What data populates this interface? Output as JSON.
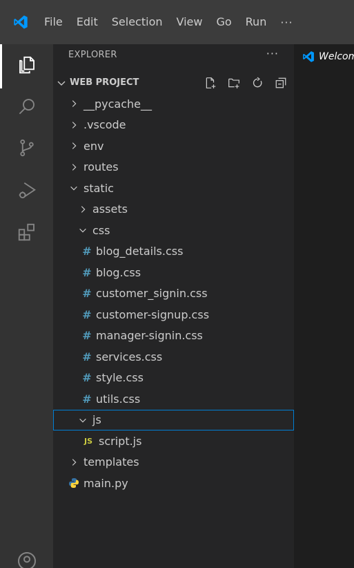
{
  "menu": {
    "items": [
      "File",
      "Edit",
      "Selection",
      "View",
      "Go",
      "Run"
    ],
    "more": "···"
  },
  "activity_bar": {
    "items": [
      {
        "name": "explorer",
        "icon": "files-icon",
        "active": true
      },
      {
        "name": "search",
        "icon": "search-icon",
        "active": false
      },
      {
        "name": "source-control",
        "icon": "source-control-icon",
        "active": false
      },
      {
        "name": "run-debug",
        "icon": "run-debug-icon",
        "active": false
      },
      {
        "name": "extensions",
        "icon": "extensions-icon",
        "active": false
      },
      {
        "name": "accounts",
        "icon": "account-icon",
        "active": false
      }
    ]
  },
  "sidebar": {
    "title": "EXPLORER",
    "more": "···",
    "section": {
      "title": "WEB PROJECT",
      "actions": [
        "new-file-icon",
        "new-folder-icon",
        "refresh-icon",
        "collapse-all-icon"
      ]
    },
    "tree": [
      {
        "label": "__pycache__",
        "type": "folder",
        "expanded": false,
        "depth": 1
      },
      {
        "label": ".vscode",
        "type": "folder",
        "expanded": false,
        "depth": 1
      },
      {
        "label": "env",
        "type": "folder",
        "expanded": false,
        "depth": 1
      },
      {
        "label": "routes",
        "type": "folder",
        "expanded": false,
        "depth": 1
      },
      {
        "label": "static",
        "type": "folder",
        "expanded": true,
        "depth": 1
      },
      {
        "label": "assets",
        "type": "folder",
        "expanded": false,
        "depth": 2
      },
      {
        "label": "css",
        "type": "folder",
        "expanded": true,
        "depth": 2
      },
      {
        "label": "blog_details.css",
        "type": "css",
        "depth": 3
      },
      {
        "label": "blog.css",
        "type": "css",
        "depth": 3
      },
      {
        "label": "customer_signin.css",
        "type": "css",
        "depth": 3
      },
      {
        "label": "customer-signup.css",
        "type": "css",
        "depth": 3
      },
      {
        "label": "manager-signin.css",
        "type": "css",
        "depth": 3
      },
      {
        "label": "services.css",
        "type": "css",
        "depth": 3
      },
      {
        "label": "style.css",
        "type": "css",
        "depth": 3
      },
      {
        "label": "utils.css",
        "type": "css",
        "depth": 3
      },
      {
        "label": "js",
        "type": "folder",
        "expanded": true,
        "depth": 2,
        "selected": true
      },
      {
        "label": "script.js",
        "type": "js",
        "depth": 3
      },
      {
        "label": "templates",
        "type": "folder",
        "expanded": false,
        "depth": 1
      },
      {
        "label": "main.py",
        "type": "py",
        "depth": 1
      }
    ]
  },
  "editor": {
    "tab_label": "Welcome"
  },
  "colors": {
    "accent": "#007fd4",
    "vscode_blue": "#0098ff",
    "css_hash": "#519aba",
    "js_badge": "#cbcb41",
    "python_blue": "#3572A5",
    "python_yellow": "#FFD43B"
  }
}
